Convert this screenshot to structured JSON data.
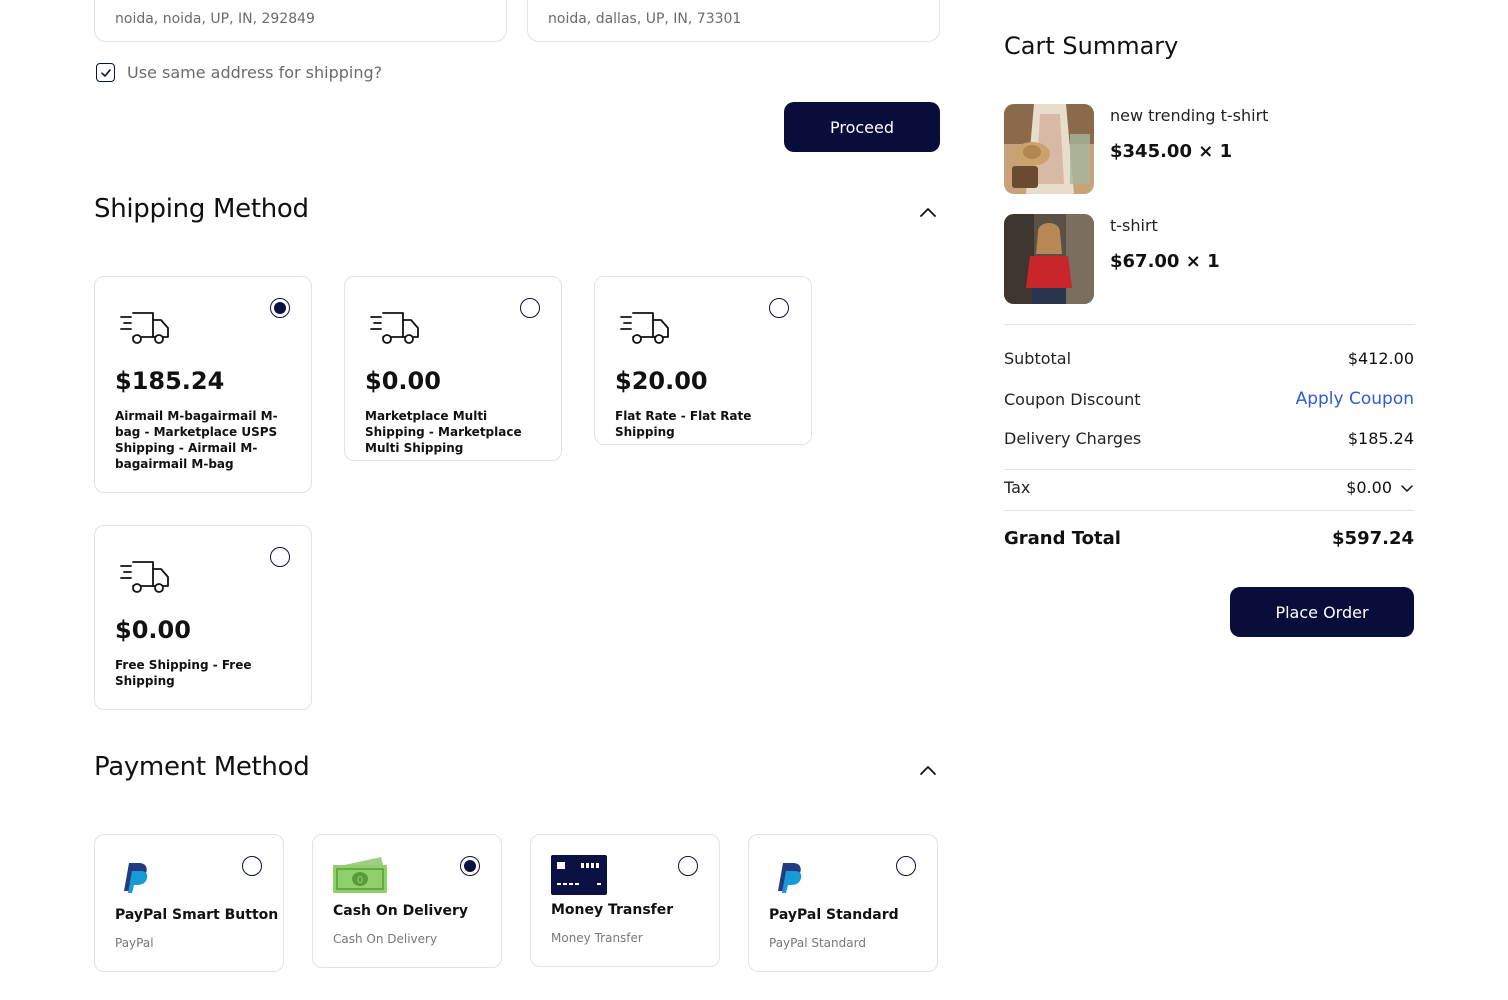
{
  "addresses": {
    "billing": "noida, noida, UP, IN, 292849",
    "shipping": "noida, dallas, UP, IN, 73301"
  },
  "same_address": {
    "label": "Use same address for shipping?",
    "checked": true
  },
  "proceed_label": "Proceed",
  "shipping_method": {
    "title": "Shipping Method",
    "options": [
      {
        "price": "$185.24",
        "description": "Airmail M-bagairmail M-bag - Marketplace USPS Shipping - Airmail M-bagairmail M-bag",
        "selected": true
      },
      {
        "price": "$0.00",
        "description": "Marketplace Multi Shipping - Marketplace Multi Shipping",
        "selected": false
      },
      {
        "price": "$20.00",
        "description": "Flat Rate - Flat Rate Shipping",
        "selected": false
      },
      {
        "price": "$0.00",
        "description": "Free Shipping - Free Shipping",
        "selected": false
      }
    ]
  },
  "payment_method": {
    "title": "Payment Method",
    "options": [
      {
        "title": "PayPal Smart Button",
        "subtitle": "PayPal",
        "icon": "paypal-icon",
        "selected": false
      },
      {
        "title": "Cash On Delivery",
        "subtitle": "Cash On Delivery",
        "icon": "cash-icon",
        "selected": true
      },
      {
        "title": "Money Transfer",
        "subtitle": "Money Transfer",
        "icon": "card-icon",
        "selected": false
      },
      {
        "title": "PayPal Standard",
        "subtitle": "PayPal Standard",
        "icon": "paypal-icon",
        "selected": false
      }
    ]
  },
  "cart_summary": {
    "title": "Cart Summary",
    "items": [
      {
        "name": "new trending t-shirt",
        "price": "$345.00 × 1"
      },
      {
        "name": "t-shirt",
        "price": "$67.00 × 1"
      }
    ],
    "subtotal_label": "Subtotal",
    "subtotal_value": "$412.00",
    "coupon_label": "Coupon Discount",
    "coupon_action": "Apply Coupon",
    "delivery_label": "Delivery Charges",
    "delivery_value": "$185.24",
    "tax_label": "Tax",
    "tax_value": "$0.00",
    "grand_total_label": "Grand Total",
    "grand_total_value": "$597.24",
    "place_order_label": "Place Order"
  },
  "colors": {
    "primary": "#080d3b",
    "link": "#2f5bd3",
    "border": "#e2e2e2",
    "muted_text": "#6b6b6b"
  }
}
